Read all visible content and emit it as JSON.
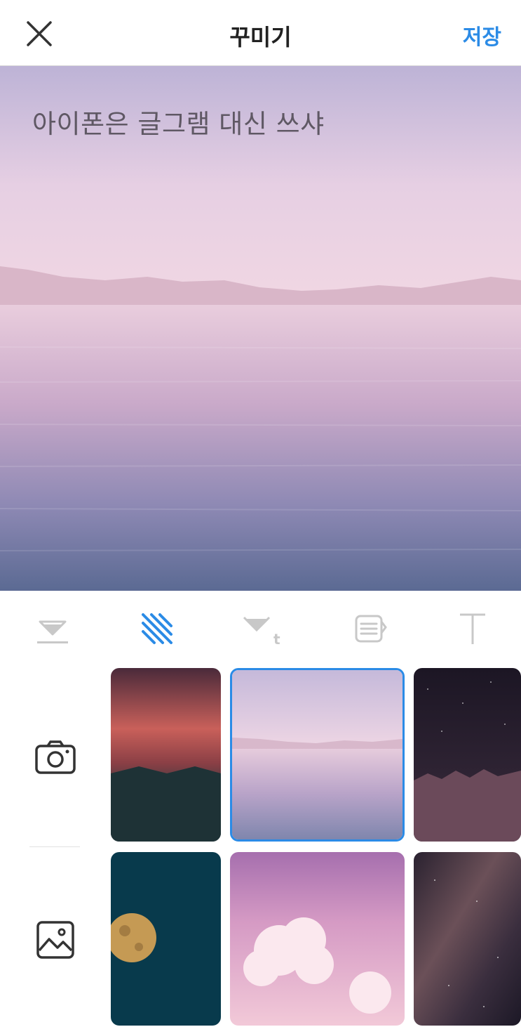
{
  "header": {
    "title": "꾸미기",
    "save_label": "저장",
    "close_icon": "close-icon"
  },
  "canvas": {
    "overlay_text": "아이폰은 글그램 대신 쓰샤",
    "background": "pink-sea-landscape"
  },
  "tools": [
    {
      "icon": "fill-color-icon",
      "active": false
    },
    {
      "icon": "pattern-background-icon",
      "active": true
    },
    {
      "icon": "text-color-icon",
      "active": false
    },
    {
      "icon": "text-align-icon",
      "active": false
    },
    {
      "icon": "font-icon",
      "active": false
    }
  ],
  "sidebar": {
    "camera_icon": "camera-icon",
    "gallery_icon": "gallery-image-icon"
  },
  "thumbnails": [
    {
      "name": "sunset-clouds",
      "selected": false
    },
    {
      "name": "pink-sea",
      "selected": true
    },
    {
      "name": "starry-forest",
      "selected": false
    },
    {
      "name": "moon",
      "selected": false
    },
    {
      "name": "pink-clouds",
      "selected": false
    },
    {
      "name": "night-sky",
      "selected": false
    }
  ],
  "colors": {
    "accent": "#2b8be6",
    "inactive_icon": "#c8c8c8",
    "text_dark": "#222222"
  }
}
